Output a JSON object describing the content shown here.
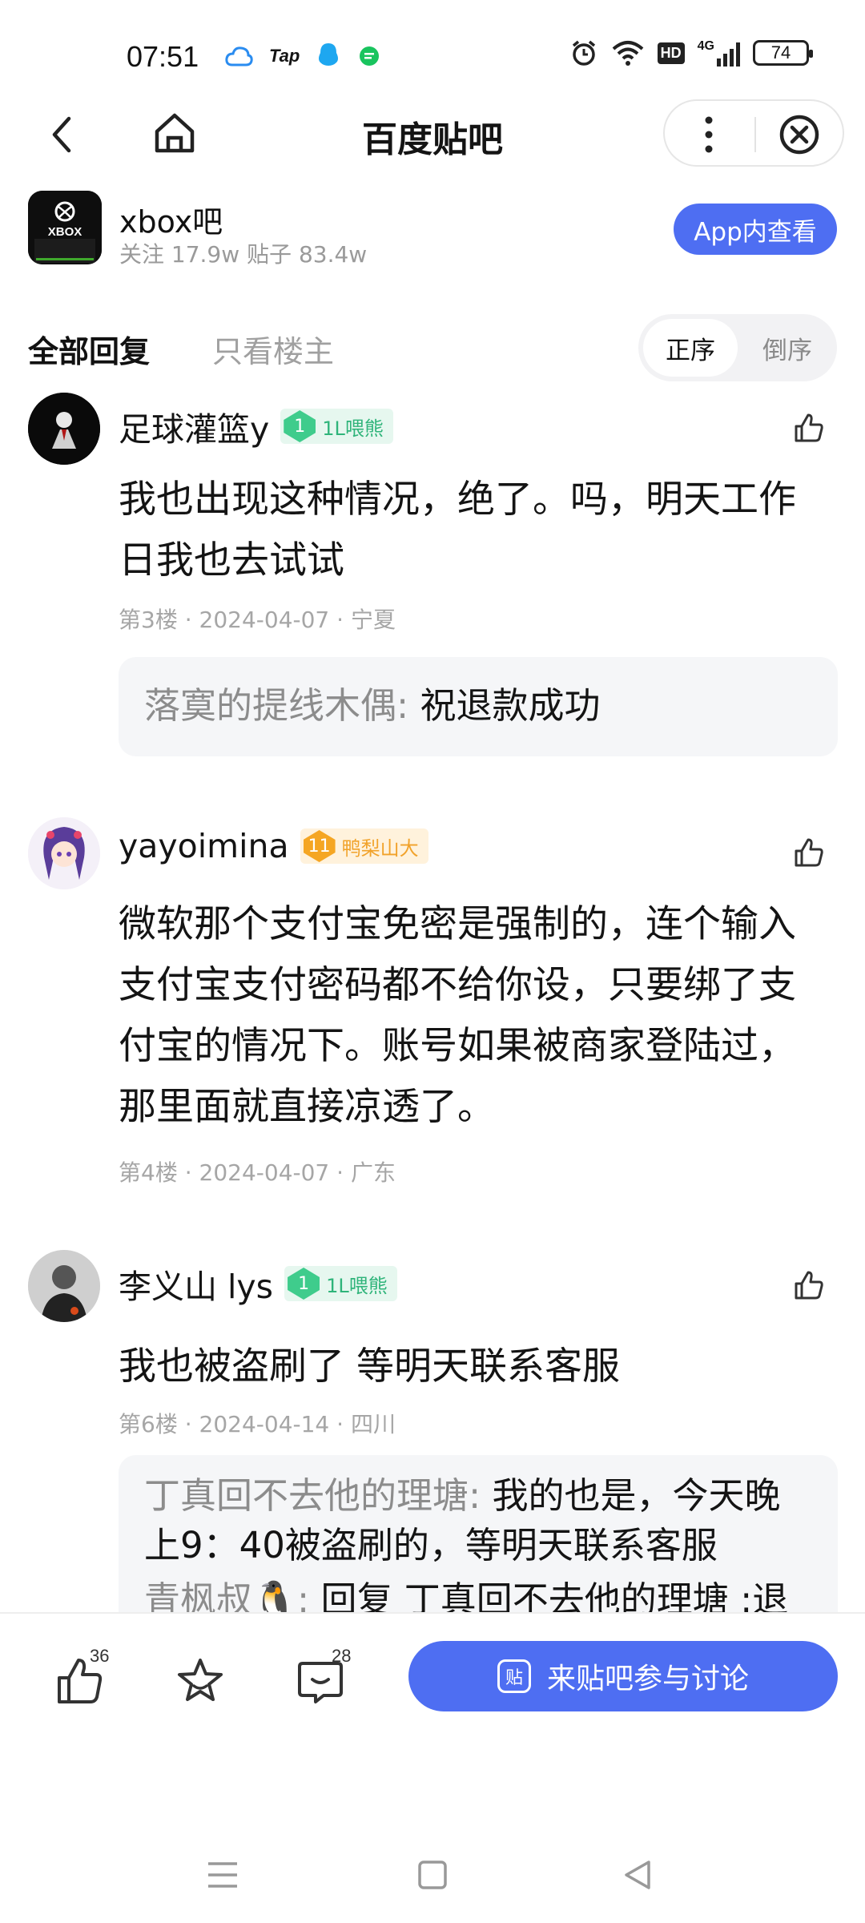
{
  "status_bar": {
    "time": "07:51",
    "left_icons": [
      "cloud-icon",
      "tap-icon",
      "qq-icon",
      "chat-icon"
    ],
    "tap_label": "Tap",
    "right_icons": [
      "alarm-icon",
      "wifi-icon",
      "hd-icon",
      "signal-4g-icon"
    ],
    "hd_label": "HD",
    "net_label": "4G",
    "battery": "74"
  },
  "nav": {
    "title": "百度贴吧"
  },
  "forum": {
    "name": "xbox吧",
    "logo_text": "XBOX",
    "stats": "关注 17.9w  贴子 83.4w",
    "open_app_label": "App内查看"
  },
  "tabs": {
    "all_replies": "全部回复",
    "op_only": "只看楼主",
    "order_asc": "正序",
    "order_desc": "倒序"
  },
  "posts": [
    {
      "author": "足球灌篮y",
      "level": "1",
      "badge": "1L喂熊",
      "content": "我也出现这种情况，绝了。吗，明天工作日我也去试试",
      "meta": "第3楼 · 2024-04-07 · 宁夏",
      "replies": [
        {
          "user": "落寞的提线木偶:",
          "text": " 祝退款成功"
        }
      ]
    },
    {
      "author": "yayoimina",
      "level": "11",
      "badge": "鸭梨山大",
      "content": "微软那个支付宝免密是强制的，连个输入支付宝支付密码都不给你设，只要绑了支付宝的情况下。账号如果被商家登陆过，那里面就直接凉透了。",
      "meta": "第4楼 · 2024-04-07 · 广东"
    },
    {
      "author": "李义山 lys",
      "level": "1",
      "badge": "1L喂熊",
      "content": "我也被盗刷了 等明天联系客服",
      "meta": "第6楼 · 2024-04-14 · 四川",
      "replies": [
        {
          "user": "丁真回不去他的理塘:",
          "text": " 我的也是，今天晚上9：40被盗刷的，等明天联系客服"
        },
        {
          "user": "青枫叔🐧:",
          "text": " 回复 丁真回不去他的理塘 :退"
        }
      ]
    }
  ],
  "bottom_bar": {
    "like_count": "36",
    "comment_count": "28",
    "cta_icon_label": "贴",
    "cta_label": "来贴吧参与讨论"
  },
  "colors": {
    "accent": "#4e6ef2",
    "badge_green": "#3fcc8c",
    "badge_orange": "#f5a623"
  }
}
